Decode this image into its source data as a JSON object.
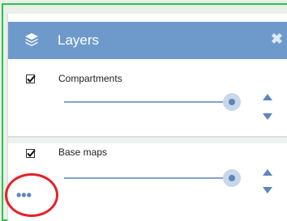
{
  "panel": {
    "title": "Layers",
    "close_glyph": "✖",
    "icon": "layers-icon"
  },
  "layers": [
    {
      "label": "Compartments",
      "checked": true,
      "opacity": 0.96
    },
    {
      "label": "Base maps",
      "checked": true,
      "opacity": 0.96
    }
  ],
  "more_button": {
    "glyph": "•••"
  },
  "colors": {
    "header_bg": "#6e9acb",
    "accent": "#5b86bd",
    "highlight_border": "#2dc24a",
    "annotation": "#e8202a"
  }
}
